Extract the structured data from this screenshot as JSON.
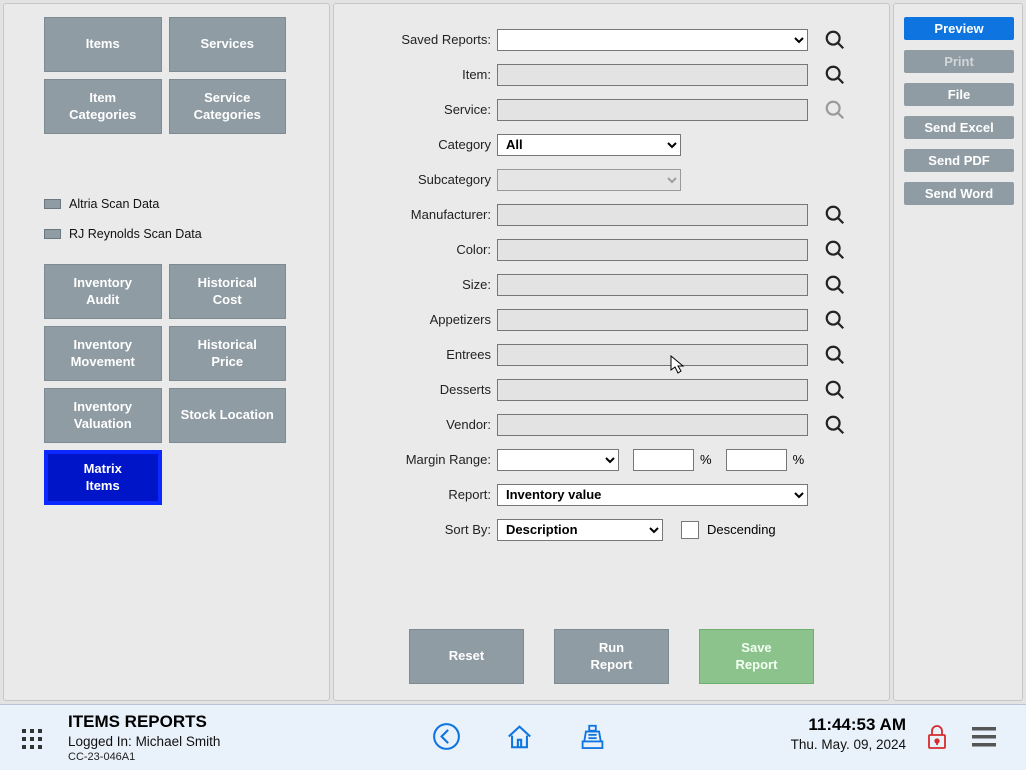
{
  "left": {
    "top_buttons": [
      {
        "name": "nav-items",
        "label": "Items"
      },
      {
        "name": "nav-services",
        "label": "Services"
      },
      {
        "name": "nav-item-categories",
        "label": "Item\nCategories"
      },
      {
        "name": "nav-service-categories",
        "label": "Service\nCategories"
      }
    ],
    "scan_items": [
      {
        "name": "altria-scan",
        "label": "Altria Scan Data"
      },
      {
        "name": "rj-reynolds-scan",
        "label": "RJ Reynolds Scan Data"
      }
    ],
    "bottom_buttons": [
      {
        "name": "nav-inventory-audit",
        "label": "Inventory\nAudit",
        "active": false
      },
      {
        "name": "nav-historical-cost",
        "label": "Historical\nCost",
        "active": false
      },
      {
        "name": "nav-inventory-movement",
        "label": "Inventory\nMovement",
        "active": false
      },
      {
        "name": "nav-historical-price",
        "label": "Historical\nPrice",
        "active": false
      },
      {
        "name": "nav-inventory-valuation",
        "label": "Inventory\nValuation",
        "active": false
      },
      {
        "name": "nav-stock-location",
        "label": "Stock Location",
        "active": false
      },
      {
        "name": "nav-matrix-items",
        "label": "Matrix\nItems",
        "active": true
      }
    ]
  },
  "form": {
    "saved_reports_label": "Saved Reports:",
    "item_label": "Item:",
    "service_label": "Service:",
    "category_label": "Category",
    "category_value": "All",
    "subcategory_label": "Subcategory",
    "manufacturer_label": "Manufacturer:",
    "color_label": "Color:",
    "size_label": "Size:",
    "appetizers_label": "Appetizers",
    "entrees_label": "Entrees",
    "desserts_label": "Desserts",
    "vendor_label": "Vendor:",
    "margin_label": "Margin Range:",
    "margin_pct": "%",
    "report_label": "Report:",
    "report_value": "Inventory value",
    "sort_label": "Sort By:",
    "sort_value": "Description",
    "descending_label": "Descending"
  },
  "actions": {
    "reset": "Reset",
    "run": "Run\nReport",
    "save": "Save\nReport"
  },
  "right": {
    "preview": "Preview",
    "print": "Print",
    "file": "File",
    "excel": "Send Excel",
    "pdf": "Send PDF",
    "word": "Send Word"
  },
  "footer": {
    "title": "ITEMS REPORTS",
    "logged_prefix": "Logged In:  ",
    "user": "Michael Smith",
    "register": "CC-23-046A1",
    "time": "11:44:53 AM",
    "date": "Thu. May. 09, 2024"
  },
  "colors": {
    "accent_blue": "#0e74e0",
    "nav_gray": "#909ca3",
    "active_blue": "#0015c8",
    "save_green": "#8cc38c"
  }
}
